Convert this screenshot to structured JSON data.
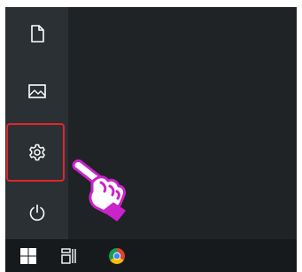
{
  "start_menu": {
    "items": [
      {
        "name": "documents",
        "icon": "document-icon"
      },
      {
        "name": "pictures",
        "icon": "picture-icon"
      },
      {
        "name": "settings",
        "icon": "gear-icon",
        "highlighted": true
      },
      {
        "name": "power",
        "icon": "power-icon"
      }
    ]
  },
  "taskbar": {
    "items": [
      {
        "name": "start",
        "icon": "windows-logo-icon"
      },
      {
        "name": "task-view",
        "icon": "task-view-icon"
      },
      {
        "name": "chrome",
        "icon": "chrome-icon"
      }
    ]
  },
  "colors": {
    "rail": "#2b3034",
    "menu": "#1f2326",
    "taskbar": "#171a1c",
    "highlight": "#e0262c",
    "pointer": "#cc22cc"
  }
}
